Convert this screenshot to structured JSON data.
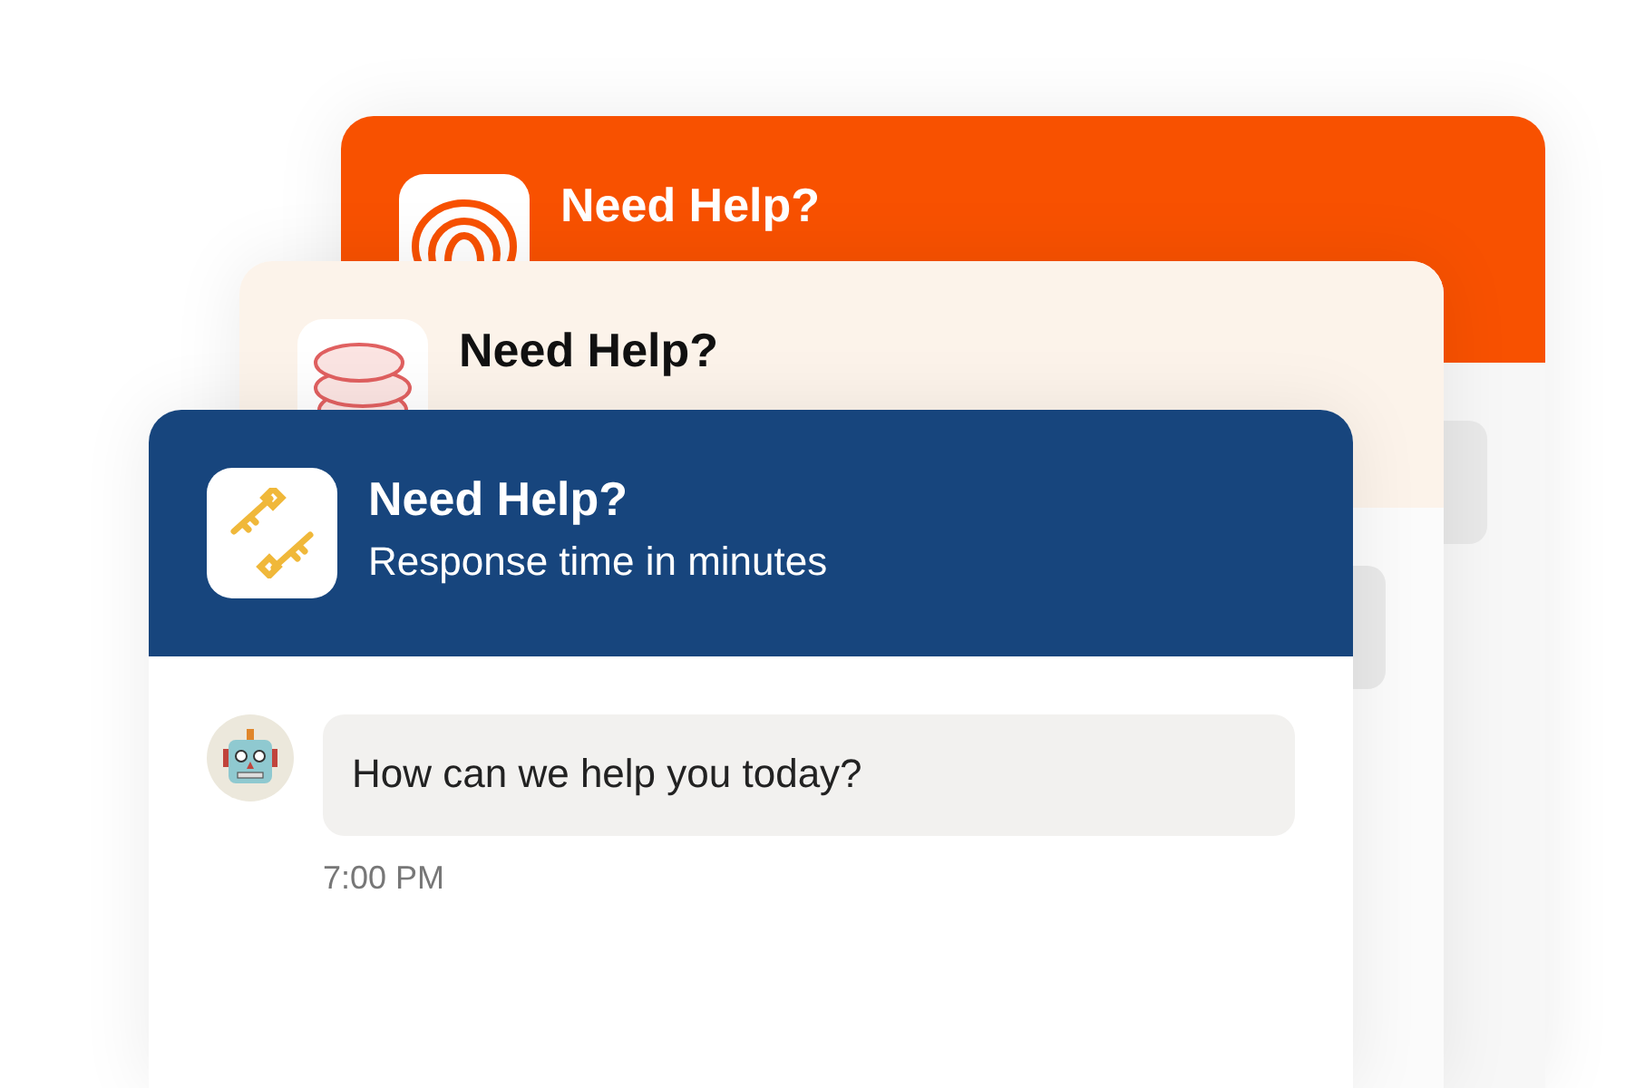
{
  "widgets": [
    {
      "kind": "rings",
      "color": "#f85100",
      "title": "Need Help?"
    },
    {
      "kind": "discs",
      "color": "#fcf3ea",
      "title": "Need Help?"
    },
    {
      "kind": "keys",
      "color": "#17457d",
      "title": "Need Help?",
      "subtitle": "Response time in minutes",
      "messages": [
        {
          "kind": "bot",
          "text": "How can we help you today?",
          "time": "7:00 PM"
        }
      ]
    }
  ]
}
